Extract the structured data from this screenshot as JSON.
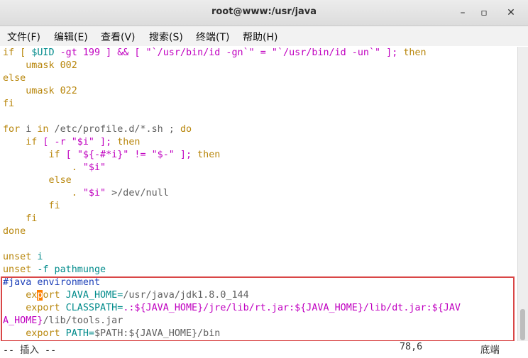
{
  "window": {
    "title": "root@www:/usr/java",
    "minimize_glyph": "–",
    "maximize_glyph": "▫",
    "close_glyph": "✕"
  },
  "menu": [
    "文件(F)",
    "编辑(E)",
    "查看(V)",
    "搜索(S)",
    "终端(T)",
    "帮助(H)"
  ],
  "editor": {
    "l1_a": "if [ ",
    "l1_b": "$UID",
    "l1_c": " -gt 199 ] && [ \"`/usr/bin/id -gn`\" = \"`/usr/bin/id -un`\" ]; ",
    "l1_d": "then",
    "l2": "    umask 002",
    "l3": "else",
    "l4": "    umask 022",
    "l5": "fi",
    "l7_a": "for",
    "l7_b": " i ",
    "l7_c": "in",
    "l7_d": " /etc/profile.d/*.sh ; ",
    "l7_e": "do",
    "l8_a": "    if",
    "l8_b": " [ -r ",
    "l8_c": "\"$i\"",
    "l8_d": " ]; ",
    "l8_e": "then",
    "l9_a": "        if",
    "l9_b": " [ ",
    "l9_c": "\"${-#*i}\"",
    "l9_d": " != ",
    "l9_e": "\"$-\"",
    "l9_f": " ]; ",
    "l9_g": "then",
    "l10_a": "            . ",
    "l10_b": "\"$i\"",
    "l11": "        else",
    "l12_a": "            . ",
    "l12_b": "\"$i\"",
    "l12_c": " >/dev/null",
    "l13": "        fi",
    "l14": "    fi",
    "l15": "done",
    "l17_a": "unset",
    "l17_b": " i",
    "l18_a": "unset",
    "l18_b": " -f pathmunge",
    "l19": "#java environment",
    "l20_a": "    ex",
    "l20_cursor": "p",
    "l20_b": "ort",
    "l20_c": " JAVA_HOME=",
    "l20_d": "/usr/java/jdk1.8.0_144",
    "l21_a": "    export",
    "l21_b": " CLASSPATH=",
    "l21_c": ".:${JAVA_HOME}/jre/lib/rt.jar:${JAVA_HOME}/lib/dt.jar:${JAV",
    "l22_a": "A_HOME}",
    "l22_b": "/lib/tools.jar",
    "l23_a": "    export",
    "l23_b": " PATH=",
    "l23_c": "$PATH:${JAVA_HOME}/bin"
  },
  "status": {
    "mode": "-- 插入 --",
    "position": "78,6",
    "scroll": "底端"
  }
}
